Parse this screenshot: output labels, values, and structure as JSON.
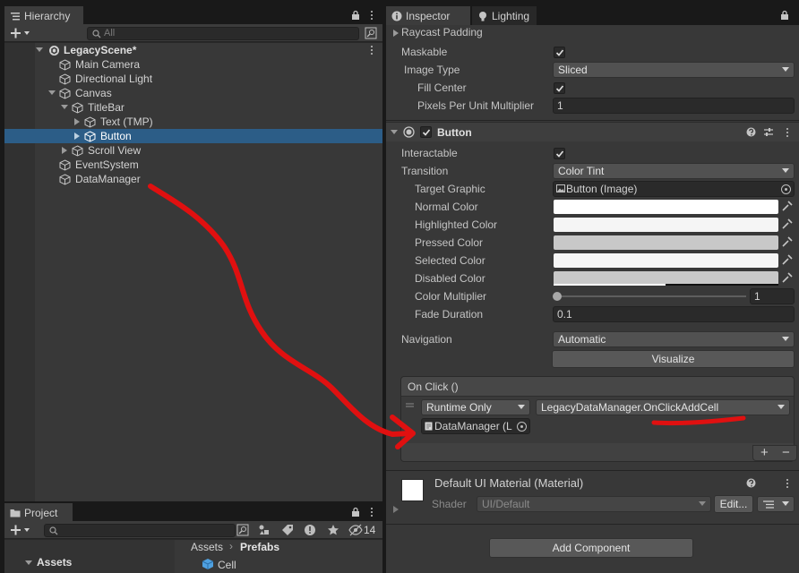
{
  "hierarchy": {
    "tab_label": "Hierarchy",
    "search_placeholder": "All",
    "items": [
      {
        "label": "LegacyScene*"
      },
      {
        "label": "Main Camera"
      },
      {
        "label": "Directional Light"
      },
      {
        "label": "Canvas"
      },
      {
        "label": "TitleBar"
      },
      {
        "label": "Text (TMP)"
      },
      {
        "label": "Button"
      },
      {
        "label": "Scroll View"
      },
      {
        "label": "EventSystem"
      },
      {
        "label": "DataManager"
      }
    ]
  },
  "project": {
    "tab_label": "Project",
    "hidden_count": "14",
    "sidebar_folder": "Assets",
    "breadcrumb": [
      "Assets",
      "Prefabs"
    ],
    "items": [
      "Cell"
    ]
  },
  "inspector": {
    "tabs": [
      "Inspector",
      "Lighting"
    ],
    "image": {
      "raycast_padding_label": "Raycast Padding",
      "maskable_label": "Maskable",
      "image_type_label": "Image Type",
      "image_type_value": "Sliced",
      "fill_center_label": "Fill Center",
      "ppu_label": "Pixels Per Unit Multiplier",
      "ppu_value": "1"
    },
    "button": {
      "title": "Button",
      "interactable_label": "Interactable",
      "transition_label": "Transition",
      "transition_value": "Color Tint",
      "target_graphic_label": "Target Graphic",
      "target_graphic_value": "Button (Image)",
      "normal_color_label": "Normal Color",
      "highlighted_color_label": "Highlighted Color",
      "pressed_color_label": "Pressed Color",
      "selected_color_label": "Selected Color",
      "disabled_color_label": "Disabled Color",
      "color_multiplier_label": "Color Multiplier",
      "color_multiplier_value": "1",
      "color_multiplier_level": 0.0,
      "fade_duration_label": "Fade Duration",
      "fade_duration_value": "0.1",
      "navigation_label": "Navigation",
      "navigation_value": "Automatic",
      "visualize_label": "Visualize",
      "colors": {
        "normal": "#ffffff",
        "highlighted": "#f5f5f5",
        "pressed": "#c8c8c8",
        "selected": "#f5f5f5",
        "disabled": "#c8c8c8"
      }
    },
    "onclick": {
      "title": "On Click ()",
      "runtime_value": "Runtime Only",
      "function_value": "LegacyDataManager.OnClickAddCell",
      "object_value": "DataManager (L",
      "add_label": "+",
      "remove_label": "−"
    },
    "material": {
      "name": "Default UI Material (Material)",
      "shader_label": "Shader",
      "shader_value": "UI/Default",
      "edit_label": "Edit..."
    },
    "add_component_label": "Add Component"
  },
  "accent_colors": {
    "selection": "#2c5d87",
    "annotation": "#e01010"
  }
}
